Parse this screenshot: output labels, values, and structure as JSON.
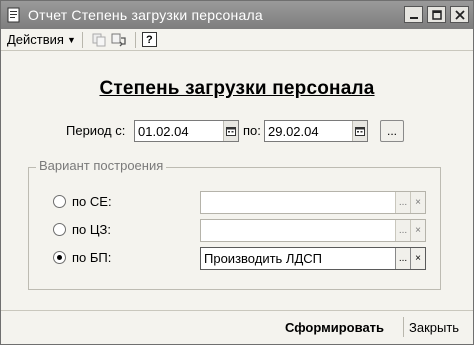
{
  "window": {
    "title": "Отчет  Степень загрузки персонала"
  },
  "toolbar": {
    "actions_label": "Действия",
    "help_label": "?"
  },
  "report": {
    "title": "Степень загрузки персонала"
  },
  "period": {
    "label_from": "Период с:",
    "date_from": "01.02.04",
    "label_to": "по:",
    "date_to": "29.02.04",
    "more_label": "..."
  },
  "variant": {
    "group_title": "Вариант построения",
    "options": [
      {
        "label": "по СЕ:",
        "value": "",
        "selected": false
      },
      {
        "label": "по ЦЗ:",
        "value": "",
        "selected": false
      },
      {
        "label": "по БП:",
        "value": "Производить ЛДСП",
        "selected": true
      }
    ],
    "select_button": "...",
    "clear_button": "×"
  },
  "footer": {
    "generate_label": "Сформировать",
    "close_label": "Закрыть"
  },
  "colors": {
    "titlebar": "#8a8a8a",
    "window_bg": "#f4f3ee"
  }
}
